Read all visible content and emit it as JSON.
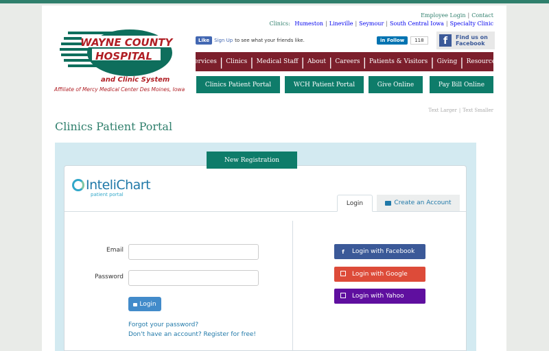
{
  "logo": {
    "line1": "WAYNE COUNTY",
    "line2": "HOSPITAL",
    "line3": "and Clinic System",
    "affiliate": "Affiliate of Mercy Medical Center Des Moines, Iowa"
  },
  "util_links": [
    "Employee Login",
    "Contact"
  ],
  "clinics": {
    "label": "Clinics:",
    "items": [
      "Humeston",
      "Lineville",
      "Seymour",
      "South Central Iowa",
      "Specialty Clinic"
    ]
  },
  "social": {
    "fb_like": "Like",
    "fb_signup": "Sign Up",
    "fb_text": "to see what your friends like.",
    "li_follow": "Follow",
    "li_count": "118",
    "fb_find_line1": "Find us on",
    "fb_find_line2": "Facebook"
  },
  "nav": [
    "Services",
    "Clinics",
    "Medical Staff",
    "About",
    "Careers",
    "Patients & Visitors",
    "Giving",
    "Resources"
  ],
  "portal_buttons": [
    "Clinics Patient Portal",
    "WCH Patient Portal",
    "Give Online",
    "Pay Bill Online"
  ],
  "text_size": {
    "larger": "Text Larger",
    "smaller": "Text Smaller"
  },
  "page_title": "Clinics Patient Portal",
  "portal": {
    "new_registration": "New Registration",
    "brand": "InteliChart",
    "brand_sub": "patient portal",
    "tab_login": "Login",
    "tab_create": "Create an Account",
    "email_label": "Email",
    "password_label": "Password",
    "email_value": "",
    "password_value": "",
    "login_button": "Login",
    "forgot": "Forgot your password?",
    "register": "Don't have an account? Register for free!",
    "social_logins": [
      {
        "label": "Login with Facebook",
        "icon": "f",
        "color": "#3b5998"
      },
      {
        "label": "Login with Google",
        "icon": "google-icon",
        "color": "#dd4b39"
      },
      {
        "label": "Login with Yahoo",
        "icon": "yahoo-icon",
        "color": "#5f0f9f"
      }
    ]
  }
}
